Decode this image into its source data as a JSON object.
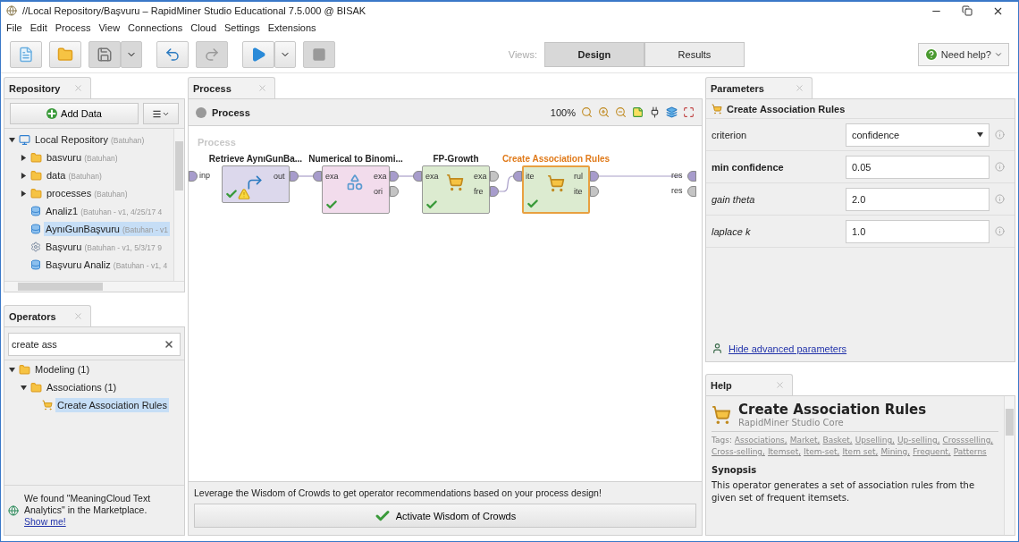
{
  "window": {
    "title": "//Local Repository/Başvuru – RapidMiner Studio Educational 7.5.000 @ BISAK"
  },
  "menu": [
    "File",
    "Edit",
    "Process",
    "View",
    "Connections",
    "Cloud",
    "Settings",
    "Extensions"
  ],
  "toolbar": {
    "views_label": "Views:",
    "views": [
      {
        "label": "Design",
        "selected": true
      },
      {
        "label": "Results",
        "selected": false
      }
    ],
    "help_button": "Need help?"
  },
  "repository": {
    "tab": "Repository",
    "add_data": "Add Data",
    "tree": [
      {
        "name": "Local Repository",
        "meta": "(Batuhan)",
        "kind": "repository",
        "expanded": true,
        "selected": false,
        "children": [
          {
            "name": "basvuru",
            "meta": "(Batuhan)",
            "kind": "folder",
            "expanded": false,
            "selected": false
          },
          {
            "name": "data",
            "meta": "(Batuhan)",
            "kind": "folder",
            "expanded": false,
            "selected": false
          },
          {
            "name": "processes",
            "meta": "(Batuhan)",
            "kind": "folder",
            "expanded": false,
            "selected": false
          },
          {
            "name": "Analiz1",
            "meta": "(Batuhan - v1, 4/25/17 4",
            "kind": "data",
            "selected": false
          },
          {
            "name": "AynıGunBaşvuru",
            "meta": "(Batuhan - v1",
            "kind": "data",
            "selected": true
          },
          {
            "name": "Başvuru",
            "meta": "(Batuhan - v1, 5/3/17 9",
            "kind": "process",
            "selected": false
          },
          {
            "name": "Başvuru Analiz",
            "meta": "(Batuhan - v1, 4",
            "kind": "data",
            "selected": false
          }
        ]
      }
    ]
  },
  "operators": {
    "tab": "Operators",
    "search": {
      "value": "create ass"
    },
    "tree": [
      {
        "name": "Modeling (1)",
        "kind": "folder",
        "expanded": true,
        "selected": false,
        "children": [
          {
            "name": "Associations (1)",
            "kind": "folder",
            "expanded": true,
            "selected": false,
            "children": [
              {
                "name": "Create Association Rules",
                "kind": "operator",
                "selected": true
              }
            ]
          }
        ]
      }
    ]
  },
  "notice": {
    "text": "We found \"MeaningCloud Text Analytics\" in the Marketplace.",
    "link": "Show me!"
  },
  "process": {
    "tab": "Process",
    "header": "Process",
    "zoom": "100%",
    "canvas_label": "Process",
    "input_port": "inp",
    "result_ports": [
      {
        "label": "res",
        "connected": true
      },
      {
        "label": "res",
        "connected": false
      }
    ],
    "nodes": [
      {
        "title": "Retrieve AynıGunBa...",
        "kind": "retrieve",
        "selected": false,
        "warning": true,
        "outputs": [
          {
            "label": "out",
            "connected": true
          }
        ]
      },
      {
        "title": "Numerical to Binomi...",
        "kind": "blending",
        "selected": false,
        "warning": false,
        "inputs": [
          {
            "label": "exa",
            "connected": true
          }
        ],
        "outputs": [
          {
            "label": "exa",
            "connected": true
          },
          {
            "label": "ori",
            "connected": false
          }
        ]
      },
      {
        "title": "FP-Growth",
        "kind": "modeling",
        "selected": false,
        "warning": false,
        "inputs": [
          {
            "label": "exa",
            "connected": true
          }
        ],
        "outputs": [
          {
            "label": "exa",
            "connected": false
          },
          {
            "label": "fre",
            "connected": true
          }
        ]
      },
      {
        "title": "Create Association Rules",
        "kind": "modeling",
        "selected": true,
        "warning": false,
        "inputs": [
          {
            "label": "ite",
            "connected": true
          }
        ],
        "outputs": [
          {
            "label": "rul",
            "connected": true
          },
          {
            "label": "ite",
            "connected": false
          }
        ]
      }
    ]
  },
  "wisdom": {
    "text": "Leverage the Wisdom of Crowds to get operator recommendations based on your process design!",
    "button": "Activate Wisdom of Crowds"
  },
  "parameters": {
    "tab": "Parameters",
    "operator": "Create Association Rules",
    "params": [
      {
        "label": "criterion",
        "required": false,
        "expert": false,
        "kind": "select",
        "value": "confidence"
      },
      {
        "label": "min confidence",
        "required": true,
        "expert": false,
        "kind": "text",
        "value": "0.05"
      },
      {
        "label": "gain theta",
        "required": false,
        "expert": true,
        "kind": "text",
        "value": "2.0"
      },
      {
        "label": "laplace k",
        "required": false,
        "expert": true,
        "kind": "text",
        "value": "1.0"
      }
    ],
    "advanced_link": "Hide advanced parameters"
  },
  "help": {
    "tab": "Help",
    "title": "Create Association Rules",
    "subtitle": "RapidMiner Studio Core",
    "tags_label": "Tags:",
    "tags": [
      "Associations,",
      "Market,",
      "Basket,",
      "Upselling,",
      "Up-selling,",
      "Crossselling,",
      "Cross-selling,",
      "Itemset,",
      "Item-set,",
      "Item set,",
      "Mining,",
      "Frequent,",
      "Patterns"
    ],
    "synopsis_heading": "Synopsis",
    "synopsis": "This operator generates a set of association rules from the given set of frequent itemsets."
  }
}
